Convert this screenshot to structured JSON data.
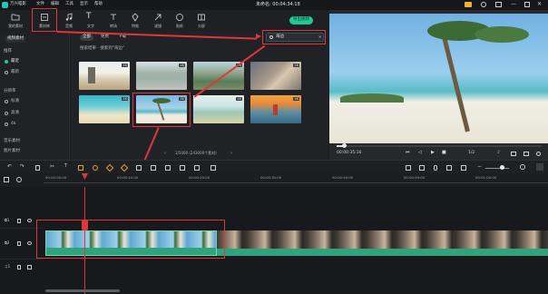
{
  "app": {
    "name": "万兴喵影",
    "menu": [
      "文件",
      "编辑",
      "工具",
      "显示",
      "帮助"
    ],
    "project_title": "未命名: 00:04:34:18"
  },
  "toolbar": {
    "items": [
      "我的素材",
      "素材库",
      "音频",
      "文字",
      "转场",
      "特效",
      "滤镜",
      "贴纸",
      "分屏"
    ],
    "export_label": "导出视频"
  },
  "left_panel": {
    "header": "视频素材",
    "sections": [
      {
        "label": "推荐",
        "items": [
          "最近",
          "最新"
        ]
      },
      {
        "label": "分辨率",
        "items": [
          "标清",
          "高清",
          "4k"
        ]
      }
    ],
    "footer": [
      "音乐素材",
      "图片素材"
    ]
  },
  "filters": {
    "tabs": [
      "全部",
      "免费",
      "下载"
    ]
  },
  "search": {
    "value": "海边",
    "placeholder": ""
  },
  "result_caption": "搜索结果 · 搜索到\"海边\"",
  "thumbnails": [
    {
      "badge": "4K"
    },
    {
      "badge": "4K"
    },
    {
      "badge": "4K"
    },
    {
      "badge": "4K"
    },
    {
      "badge": "4K"
    },
    {
      "badge": "4K"
    },
    {
      "badge": "4K"
    },
    {
      "badge": "4K"
    }
  ],
  "pagination": {
    "text": "1/5000 (243000个素材)"
  },
  "player": {
    "time_current": "00:00:35:16",
    "scale": "1/2"
  },
  "ruler": {
    "ticks": [
      "00:00:00:00",
      "00:00:10:00",
      "00:00:20:00",
      "00:00:30:00",
      "00:00:40:00",
      "00:00:50:00",
      "00:01:00:00"
    ]
  },
  "colors": {
    "accent": "#22c994",
    "highlight": "#e0373b",
    "clip": "#2fa37b"
  }
}
